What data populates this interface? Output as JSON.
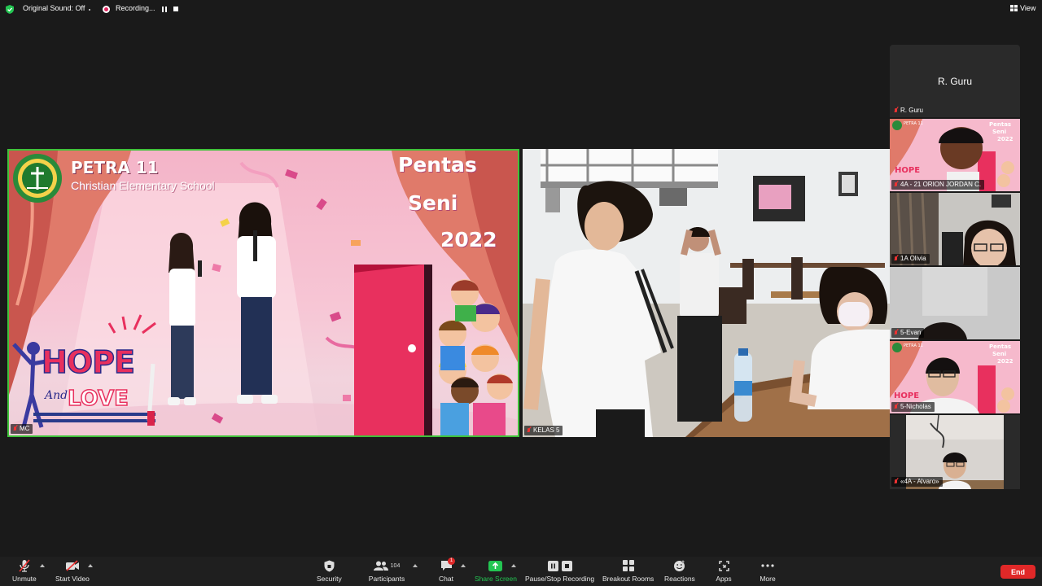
{
  "topbar": {
    "original_sound": "Original Sound: Off",
    "recording": "Recording...",
    "view": "View"
  },
  "main_tile": {
    "name": "MC",
    "school": "PETRA 11",
    "school_sub": "Christian Elementary School",
    "event_line1": "Pentas",
    "event_line2": "Seni",
    "event_line3": "2022",
    "theme_word1": "HOPE",
    "theme_and": "And",
    "theme_word2": "LOVE",
    "accent": "#3fc23a"
  },
  "class_tile": {
    "name": "KELAS 5"
  },
  "gallery": [
    {
      "name": "R. Guru",
      "display": "R. Guru"
    },
    {
      "name": "4A - 21 ORION JORDAN C."
    },
    {
      "name": "1A Olivia"
    },
    {
      "name": "5-Evan"
    },
    {
      "name": "5-Nicholas"
    },
    {
      "name": "«4A - Alvaro»"
    }
  ],
  "toolbar": {
    "unmute": "Unmute",
    "start_video": "Start Video",
    "security": "Security",
    "participants": "Participants",
    "participants_count": "104",
    "chat": "Chat",
    "chat_badge": "1",
    "share_screen": "Share Screen",
    "pause_stop": "Pause/Stop Recording",
    "breakout": "Breakout Rooms",
    "reactions": "Reactions",
    "apps": "Apps",
    "more": "More",
    "end": "End",
    "share_color": "#23c552",
    "end_color": "#e02828"
  }
}
